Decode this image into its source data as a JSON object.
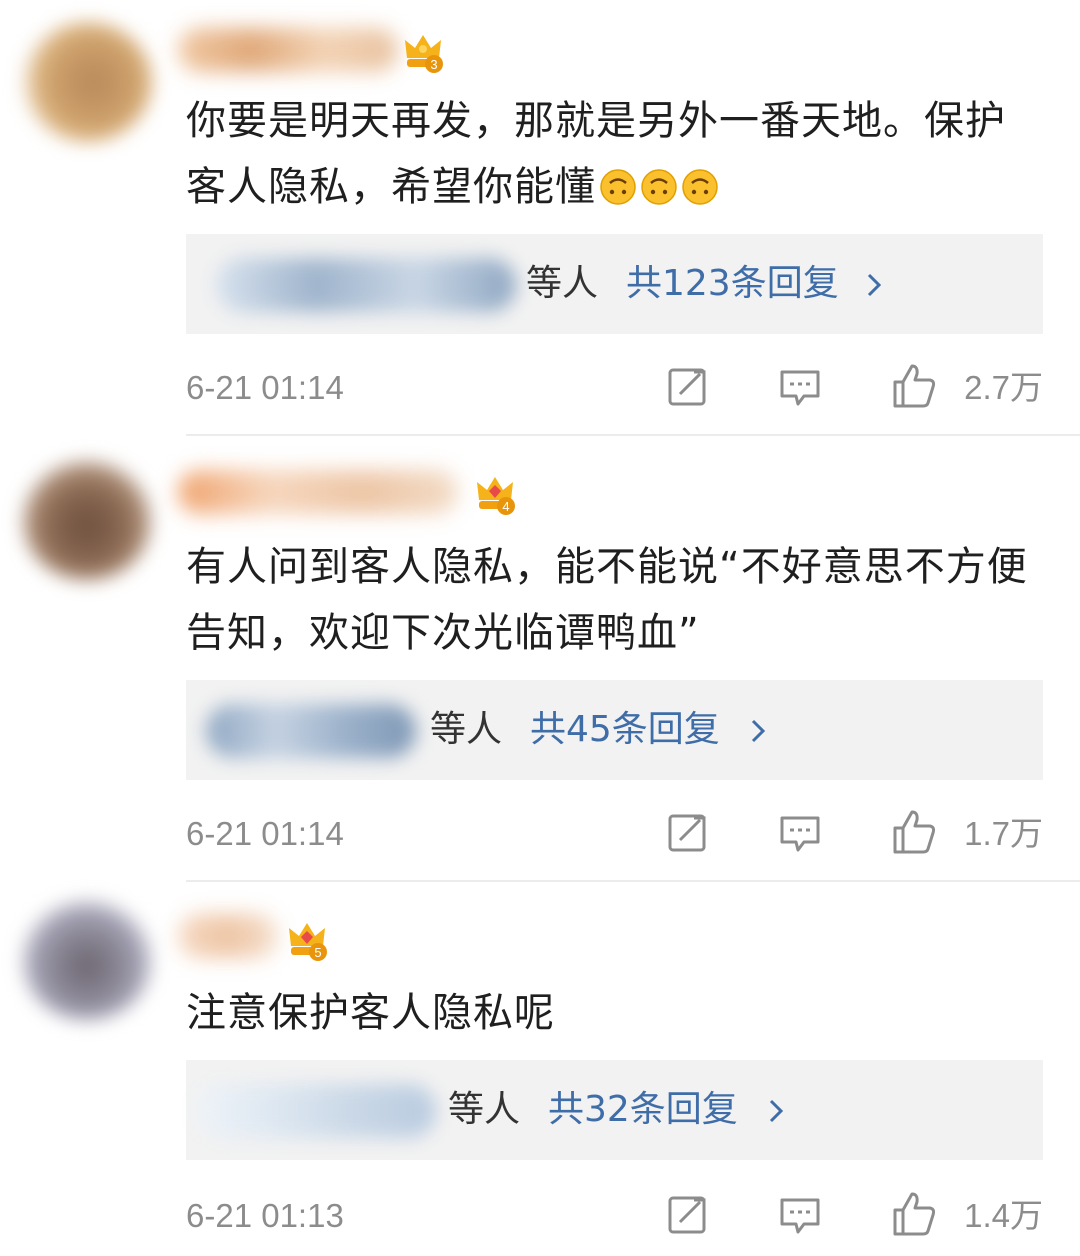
{
  "comments": [
    {
      "level": "3",
      "text": "你要是明天再发，那就是另外一番天地。保护客人隐私，希望你能懂",
      "emoji_count": 3,
      "emoji_name": "upside-down-face",
      "reply_suffix": "等人",
      "reply_count": "共123条回复",
      "time": "6-21 01:14",
      "likes": "2.7万"
    },
    {
      "level": "4",
      "text": "有人问到客人隐私，能不能说“不好意思不方便告知，欢迎下次光临谭鸭血”",
      "reply_suffix": "等人",
      "reply_count": "共45条回复",
      "time": "6-21 01:14",
      "likes": "1.7万"
    },
    {
      "level": "5",
      "text": "注意保护客人隐私呢",
      "reply_suffix": "等人",
      "reply_count": "共32条回复",
      "time": "6-21 01:13",
      "likes": "1.4万"
    }
  ],
  "icons": {
    "repost": "repost-icon",
    "comment": "comment-icon",
    "like": "thumbs-up-icon",
    "crown": "crown-badge-icon",
    "chevron": "chevron-right-icon"
  },
  "colors": {
    "reply_link": "#3f6da8",
    "meta_gray": "#8c8c8c",
    "reply_box_bg": "#f2f2f2",
    "crown_gold": "#f5b21a"
  }
}
